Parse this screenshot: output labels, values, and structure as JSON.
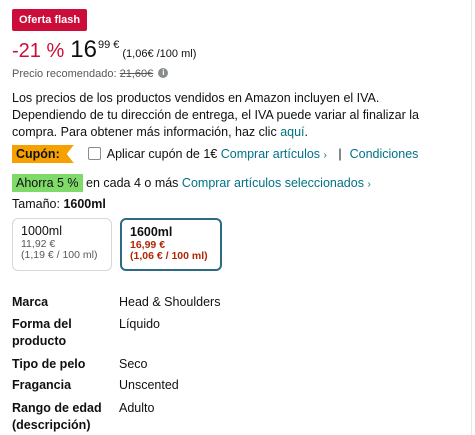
{
  "offer": {
    "badge": "Oferta flash",
    "discount": "-21 %",
    "price_whole": "16",
    "price_fraction": "99 €",
    "unit_price": "(1,06€ /100 ml)",
    "recommended_label": "Precio recomendado:",
    "recommended_price": "21,60€",
    "info_icon_glyph": "i"
  },
  "iva": {
    "text": "Los precios de los productos vendidos en Amazon incluyen el IVA. Dependiendo de tu dirección de entrega, el IVA puede variar al finalizar la compra. Para obtener más información, haz clic",
    "link": "aquí",
    "end": "."
  },
  "coupon": {
    "label": "Cupón:",
    "apply_text": "Aplicar cupón de 1€",
    "compare_link": "Comprar artículos",
    "separator": "|",
    "conditions_link": "Condiciones"
  },
  "saving": {
    "badge": "Ahorra 5 %",
    "text": "en cada 4 o más",
    "link": "Comprar artículos seleccionados",
    "chevron": "›"
  },
  "size": {
    "label": "Tamaño:",
    "selected": "1600ml",
    "options": [
      {
        "name": "1000ml",
        "price": "11,92 €",
        "unit": "(1,19 € / 100 ml)"
      },
      {
        "name": "1600ml",
        "price": "16,99 €",
        "unit": "(1,06 € / 100 ml)"
      }
    ]
  },
  "details": [
    {
      "key": "Marca",
      "value": "Head & Shoulders"
    },
    {
      "key": "Forma del producto",
      "value": "Líquido"
    },
    {
      "key": "Tipo de pelo",
      "value": "Seco"
    },
    {
      "key": "Fragancia",
      "value": "Unscented"
    },
    {
      "key": "Rango de edad (descripción)",
      "value": "Adulto"
    }
  ],
  "colors": {
    "deal_red": "#cc0c39",
    "coupon_orange": "#f7a100",
    "saving_green": "#7fda69",
    "link_teal": "#007185",
    "selected_border": "#2e6b82",
    "price_red": "#b12704"
  }
}
